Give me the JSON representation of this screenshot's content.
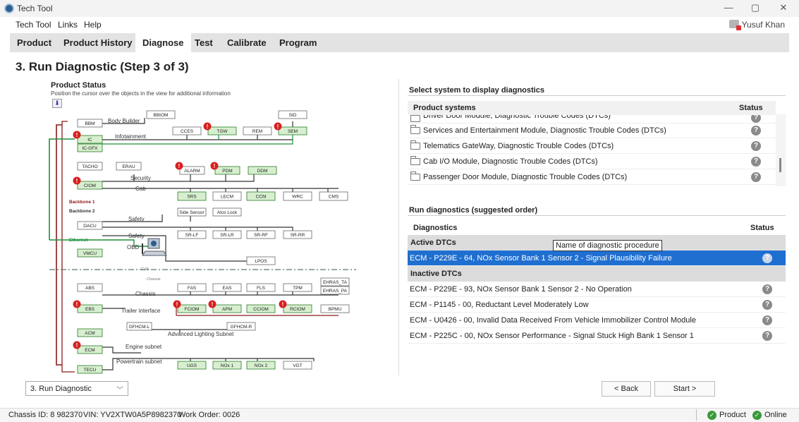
{
  "window": {
    "title": "Tech Tool",
    "controls": [
      "—",
      "▢",
      "✕"
    ]
  },
  "menu": {
    "items": [
      "Tech Tool",
      "Links",
      "Help"
    ],
    "user": "Yusuf Khan"
  },
  "tabs": [
    "Product",
    "Product History",
    "Diagnose",
    "Test",
    "Calibrate",
    "Program"
  ],
  "active_tab": "Diagnose",
  "page_title": "3. Run Diagnostic (Step 3 of 3)",
  "product_status": {
    "title": "Product Status",
    "subtitle": "Position the cursor over the objects in the view for additional information",
    "legend": [
      "Backbone 1",
      "Backbone 2",
      "Ethernet"
    ],
    "groups": [
      "Body Builder",
      "Infotainment",
      "Security",
      "Cab",
      "Safety",
      "Safety",
      "OBD",
      "Cab",
      "Chassis",
      "Chassis",
      "Trailer interface",
      "Advanced Lighting Subnet",
      "Engine subnet",
      "Powertrain subnet"
    ],
    "nodes": {
      "bbm": "BBM",
      "bbiom": "BBIOM",
      "sid": "SID",
      "ic": "IC",
      "icgfx": "IC-GFX",
      "cces": "CCES",
      "tgw": "TGW",
      "rem": "REM",
      "sem": "SEM",
      "tacho": "TACHO",
      "erau": "ERAU",
      "alarm": "ALARM",
      "pdm": "PDM",
      "ddm": "DDM",
      "ciom": "CIOM",
      "srs": "SRS",
      "lecm": "LECM",
      "ccm": "CCM",
      "wrc": "WRC",
      "cms": "CMS",
      "side_sensor": "Side Sensor",
      "alco_lock": "Alco Lock",
      "dacu": "DACU",
      "srlf": "SR-LF",
      "srlr": "SR-LR",
      "srrf": "SR-RF",
      "srrr": "SR-RR",
      "vmcu": "VMCU",
      "lpos": "LPOS",
      "ehras_ta": "EHRAS_TA",
      "ehras_pa": "EHRAS_PA",
      "abs": "ABS",
      "fas": "FAS",
      "eas": "EAS",
      "fls": "FLS",
      "tpm": "TPM",
      "ebs": "EBS",
      "fciom": "FCIOM",
      "apm": "APM",
      "cciom": "CCIOM",
      "rciom": "RCIOM",
      "bpmu": "BPMU",
      "gfhcml": "GFHCM-L",
      "gfhcmr": "GFHCM-R",
      "acm": "ACM",
      "ecm": "ECM",
      "tecu": "TECU",
      "ugs": "UGS",
      "nox1": "NOx 1",
      "nox2": "NOx 2",
      "vgt": "VGT"
    }
  },
  "systems": {
    "title": "Select system to display diagnostics",
    "col_name": "Product systems",
    "col_status": "Status",
    "items": [
      "Driver Door Module, Diagnostic Trouble Codes (DTCs)",
      "Services and Entertainment Module, Diagnostic Trouble Codes (DTCs)",
      "Telematics GateWay, Diagnostic Trouble Codes (DTCs)",
      "Cab I/O Module, Diagnostic Trouble Codes (DTCs)",
      "Passenger Door Module, Diagnostic Trouble Codes (DTCs)"
    ]
  },
  "diagnostics": {
    "title": "Run diagnostics (suggested order)",
    "col_name": "Diagnostics",
    "col_status": "Status",
    "active_label": "Active DTCs",
    "active": [
      "ECM - P229E - 64, NOx Sensor Bank 1 Sensor 2 - Signal Plausibility Failure"
    ],
    "inactive_label": "Inactive DTCs",
    "inactive": [
      "ECM - P229E - 93, NOx Sensor Bank 1 Sensor 2 - No Operation",
      "ECM - P1145 - 00, Reductant Level Moderately Low",
      "ECM - U0426 - 00, Invalid Data Received From Vehicle Immobilizer Control Module",
      "ECM - P225C - 00, NOx Sensor Performance - Signal Stuck High Bank 1 Sensor 1"
    ],
    "tooltip": "Name of diagnostic procedure",
    "status_icon": "?"
  },
  "footer": {
    "step_select": "3. Run Diagnostic",
    "back": "< Back",
    "start": "Start >"
  },
  "statusbar": {
    "chassis": "Chassis ID: 8 982370",
    "vin": "VIN: YV2XTW0A5P8982370",
    "work_order": "Work Order: 0026",
    "product": "Product",
    "online": "Online"
  },
  "colors": {
    "selection": "#1f6fd1",
    "ok": "#3b9a3b",
    "alert": "#d62020",
    "backbone1": "#8b1a1a",
    "ethernet": "#1e8f3a",
    "ecu_fill": "#d7efcf"
  }
}
